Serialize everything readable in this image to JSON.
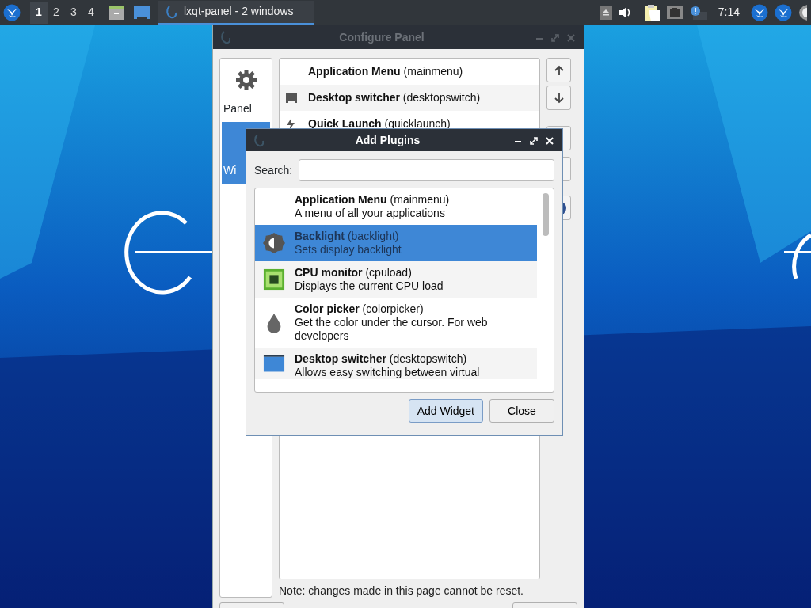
{
  "taskbar": {
    "workspaces": [
      {
        "label": "1",
        "selected": true
      },
      {
        "label": "2",
        "selected": false
      },
      {
        "label": "3",
        "selected": false
      },
      {
        "label": "4",
        "selected": false
      }
    ],
    "task": {
      "title": "lxqt-panel - 2 windows",
      "active": true
    },
    "clock": "7:14"
  },
  "configure_panel": {
    "title": "Configure Panel",
    "active": false,
    "sections": [
      {
        "label": "Panel",
        "selected": false
      },
      {
        "label": "Wi",
        "selected": true
      }
    ],
    "widgets": [
      {
        "name": "**Application Menu** (mainmenu)"
      },
      {
        "name": "**Desktop switcher** (desktopswitch)"
      },
      {
        "name": "**Quick Launch** (quicklaunch)"
      }
    ],
    "note": "Note: changes made in this page cannot be reset."
  },
  "add_plugins": {
    "title": "Add Plugins",
    "active": true,
    "search": {
      "label": "Search:"
    },
    "plugins": [
      {
        "name": "**Application Menu** (mainmenu)",
        "description": "A menu of all your applications",
        "selected": false
      },
      {
        "name": "**Backlight** (backlight)",
        "description": "Sets display backlight",
        "selected": true
      },
      {
        "name": "**CPU monitor** (cpuload)",
        "description": "Displays the current CPU load",
        "selected": false
      },
      {
        "name": "**Color picker** (colorpicker)",
        "description": "Get the color under the cursor. For web developers",
        "selected": false
      },
      {
        "name": "**Desktop switcher** (desktopswitch)",
        "description": "Allows easy switching between virtual",
        "selected": false
      }
    ],
    "buttons": [
      {
        "label": "Add Widget",
        "default": true
      },
      {
        "label": "Close",
        "default": false
      }
    ]
  }
}
